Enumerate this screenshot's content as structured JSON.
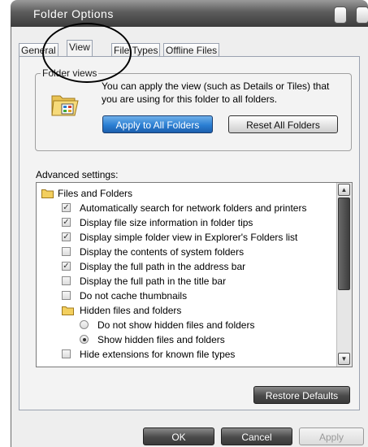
{
  "window": {
    "title": "Folder Options"
  },
  "tabs": [
    {
      "label": "General",
      "active": false
    },
    {
      "label": "View",
      "active": true
    },
    {
      "label": "File Types",
      "active": false
    },
    {
      "label": "Offline Files",
      "active": false
    }
  ],
  "folder_views": {
    "label": "Folder views",
    "description": "You can apply the view (such as Details or Tiles) that you are using for this folder to all folders.",
    "apply_button": "Apply to All Folders",
    "reset_button": "Reset All Folders"
  },
  "advanced": {
    "label": "Advanced settings:",
    "items": [
      {
        "type": "folder",
        "label": "Files and Folders"
      },
      {
        "type": "checkbox",
        "checked": true,
        "label": "Automatically search for network folders and printers"
      },
      {
        "type": "checkbox",
        "checked": true,
        "label": "Display file size information in folder tips"
      },
      {
        "type": "checkbox",
        "checked": true,
        "label": "Display simple folder view in Explorer's Folders list"
      },
      {
        "type": "checkbox",
        "checked": false,
        "label": "Display the contents of system folders"
      },
      {
        "type": "checkbox",
        "checked": true,
        "label": "Display the full path in the address bar"
      },
      {
        "type": "checkbox",
        "checked": false,
        "label": "Display the full path in the title bar"
      },
      {
        "type": "checkbox",
        "checked": false,
        "label": "Do not cache thumbnails"
      },
      {
        "type": "folder",
        "label": "Hidden files and folders"
      },
      {
        "type": "radio",
        "checked": false,
        "label": "Do not show hidden files and folders"
      },
      {
        "type": "radio",
        "checked": true,
        "label": "Show hidden files and folders"
      },
      {
        "type": "checkbox",
        "checked": false,
        "label": "Hide extensions for known file types"
      }
    ],
    "restore_button": "Restore Defaults"
  },
  "footer": {
    "ok": "OK",
    "cancel": "Cancel",
    "apply": "Apply"
  },
  "colors": {
    "accent_blue": "#2b7fd3",
    "titlebar_dark": "#3c3c3c",
    "check_mark": "#333333"
  }
}
